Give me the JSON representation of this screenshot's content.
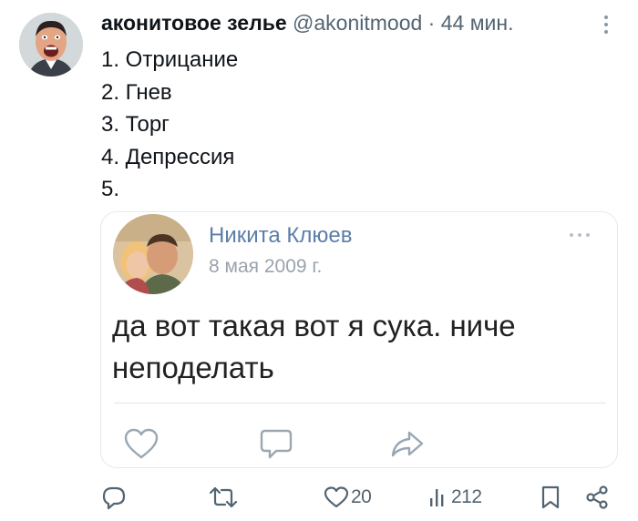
{
  "tweet": {
    "display_name": "аконитовое зелье",
    "handle": "@akonitmood",
    "separator": "·",
    "time": "44 мин.",
    "lines": [
      "1. Отрицание",
      "2. Гнев",
      "3. Торг",
      "4. Депрессия",
      "5."
    ]
  },
  "quoted_post": {
    "author": "Никита Клюев",
    "date": "8 мая 2009 г.",
    "text": "да вот такая вот я сука. ниче неподелать",
    "actions": [
      "heart-outline-icon",
      "comment-bubble-icon",
      "share-arrow-icon"
    ]
  },
  "actions": {
    "reply_icon": "reply-icon",
    "retweet_icon": "retweet-icon",
    "likes": "20",
    "views": "212",
    "bookmark_icon": "bookmark-icon",
    "share_icon": "share-icon"
  },
  "colors": {
    "text_primary": "#0f1419",
    "text_secondary": "#536471",
    "quoted_name": "#5b7ea6",
    "quoted_date": "#9aa3ad",
    "border": "#e6e9eb"
  }
}
